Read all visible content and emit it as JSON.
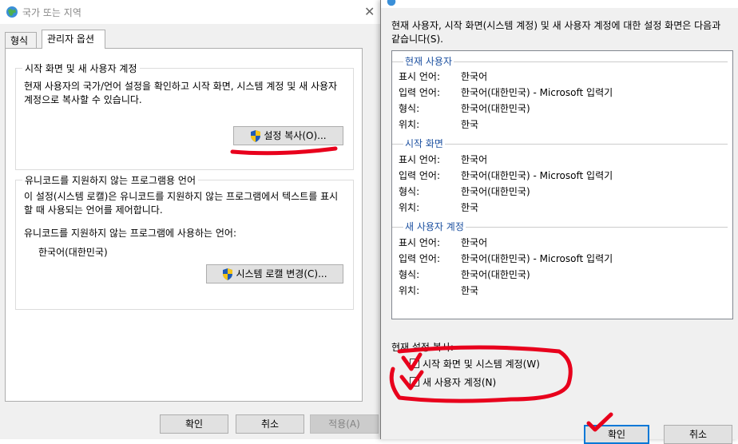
{
  "left_dialog": {
    "title": "국가 또는 지역",
    "tabs": [
      {
        "label": "형식"
      },
      {
        "label": "관리자 옵션"
      }
    ],
    "welcome_group": {
      "title": "시작 화면 및 새 사용자 계정",
      "description": "현재 사용자의 국가/언어 설정을 확인하고 시작 화면, 시스템 계정 및 새 사용자 계정으로 복사할 수 있습니다.",
      "copy_button": "설정 복사(O)..."
    },
    "unicode_group": {
      "title": "유니코드를 지원하지 않는 프로그램용 언어",
      "description": "이 설정(시스템 로캘)은 유니코드를 지원하지 않는 프로그램에서 텍스트를 표시할 때 사용되는 언어를 제어합니다.",
      "prompt": "유니코드를 지원하지 않는 프로그램에 사용하는 언어:",
      "value": "한국어(대한민국)",
      "change_button": "시스템 로캘 변경(C)..."
    },
    "buttons": {
      "ok": "확인",
      "cancel": "취소",
      "apply": "적용(A)"
    }
  },
  "right_dialog": {
    "intro": "현재 사용자, 시작 화면(시스템 계정) 및 새 사용자 계정에 대한 설정 화면은 다음과 같습니다(S).",
    "sections": [
      {
        "header": "현재 사용자",
        "rows": [
          {
            "label": "표시 언어:",
            "value": "한국어"
          },
          {
            "label": "입력 언어:",
            "value": "한국어(대한민국) - Microsoft 입력기"
          },
          {
            "label": "형식:",
            "value": "한국어(대한민국)"
          },
          {
            "label": "위치:",
            "value": "한국"
          }
        ]
      },
      {
        "header": "시작 화면",
        "rows": [
          {
            "label": "표시 언어:",
            "value": "한국어"
          },
          {
            "label": "입력 언어:",
            "value": "한국어(대한민국) - Microsoft 입력기"
          },
          {
            "label": "형식:",
            "value": "한국어(대한민국)"
          },
          {
            "label": "위치:",
            "value": "한국"
          }
        ]
      },
      {
        "header": "새 사용자 계정",
        "rows": [
          {
            "label": "표시 언어:",
            "value": "한국어"
          },
          {
            "label": "입력 언어:",
            "value": "한국어(대한민국) - Microsoft 입력기"
          },
          {
            "label": "형식:",
            "value": "한국어(대한민국)"
          },
          {
            "label": "위치:",
            "value": "한국"
          }
        ]
      }
    ],
    "copy_heading": "현재 설정 복사:",
    "checkboxes": [
      {
        "label": "시작 화면 및 시스템 계정(W)"
      },
      {
        "label": "새 사용자 계정(N)"
      }
    ],
    "buttons": {
      "ok": "확인",
      "cancel": "취소"
    }
  },
  "colors": {
    "annotation": "#e8001c",
    "link_blue": "#1c50a0",
    "focus_border": "#0078d7"
  },
  "icons": [
    "globe-icon",
    "close-icon",
    "shield-icon"
  ]
}
